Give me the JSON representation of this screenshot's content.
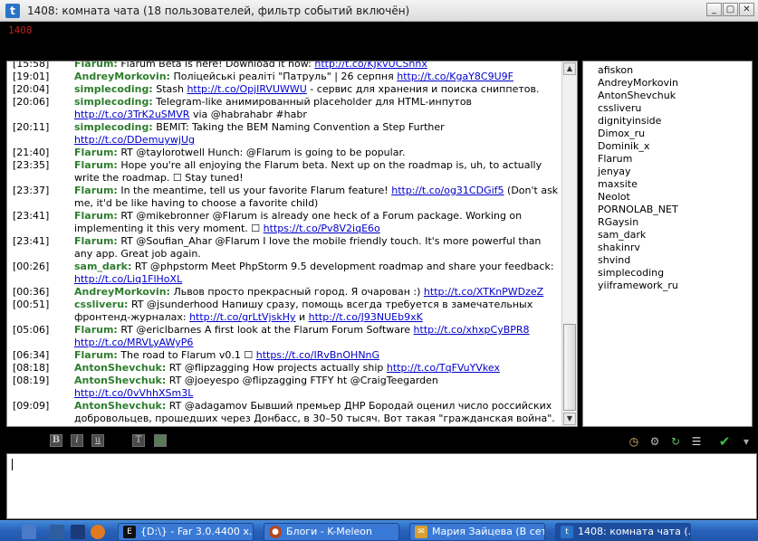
{
  "window": {
    "title": "1408: комната чата (18 пользователей, фильтр событий включён)",
    "app_icon_glyph": "t",
    "controls": {
      "minimize": "_",
      "restore": "▢",
      "close": "✕"
    }
  },
  "room": {
    "number": "1408"
  },
  "messages": [
    {
      "time": "[15:58]",
      "nick": "Flarum:",
      "parts": [
        {
          "t": " Flarum Beta is here! Download it now: "
        },
        {
          "l": "http://t.co/KJkvUCShnx"
        }
      ]
    },
    {
      "time": "[19:01]",
      "nick": "AndreyMorkovin:",
      "parts": [
        {
          "t": " Поліцейські реаліті \"Патруль\" | 26 серпня "
        },
        {
          "l": "http://t.co/KgaY8C9U9F"
        }
      ]
    },
    {
      "time": "[20:04]",
      "nick": "simplecoding:",
      "parts": [
        {
          "t": " Stash "
        },
        {
          "l": "http://t.co/OpjIRVUWWU"
        },
        {
          "t": " - сервис для хранения и поиска сниппетов."
        }
      ]
    },
    {
      "time": "[20:06]",
      "nick": "simplecoding:",
      "parts": [
        {
          "t": " Telegram-like анимированный placeholder для HTML-инпутов "
        },
        {
          "l": "http://t.co/3TrK2uSMVR"
        },
        {
          "t": " via @habrahabr #habr"
        }
      ]
    },
    {
      "time": "[20:11]",
      "nick": "simplecoding:",
      "parts": [
        {
          "t": " BEMIT: Taking the BEM Naming Convention a Step Further "
        },
        {
          "l": "http://t.co/DDemuywjUg"
        }
      ]
    },
    {
      "time": "[21:40]",
      "nick": "Flarum:",
      "parts": [
        {
          "t": " RT @taylorotwell Hunch: @Flarum is going to be popular."
        }
      ]
    },
    {
      "time": "[23:35]",
      "nick": "Flarum:",
      "parts": [
        {
          "t": " Hope you're all enjoying the Flarum beta. Next up on the roadmap is, uh, to actually write the roadmap. ☐ Stay tuned!"
        }
      ]
    },
    {
      "time": "[23:37]",
      "nick": "Flarum:",
      "parts": [
        {
          "t": " In the meantime, tell us your favorite Flarum feature! "
        },
        {
          "l": "http://t.co/og31CDGif5"
        },
        {
          "t": " (Don't ask me, it'd be like having to choose a favorite child)"
        }
      ]
    },
    {
      "time": "[23:41]",
      "nick": "Flarum:",
      "parts": [
        {
          "t": " RT @mikebronner @Flarum is already one heck of a Forum package. Working on implementing it this very moment. ☐ "
        },
        {
          "l": "https://t.co/Pv8V2iqE6o"
        }
      ]
    },
    {
      "time": "[23:41]",
      "nick": "Flarum:",
      "parts": [
        {
          "t": " RT @Soufian_Ahar @Flarum I love the mobile friendly touch. It's more powerful than any app. Great job again."
        }
      ]
    },
    {
      "time": "[00:26]",
      "nick": "sam_dark:",
      "parts": [
        {
          "t": " RT @phpstorm Meet PhpStorm 9.5 development roadmap and share your feedback: "
        },
        {
          "l": "http://t.co/Liq1FlHoXL"
        }
      ]
    },
    {
      "time": "[00:36]",
      "nick": "AndreyMorkovin:",
      "parts": [
        {
          "t": " Львов просто прекрасный город. Я очарован :) "
        },
        {
          "l": "http://t.co/XTKnPWDzeZ"
        }
      ]
    },
    {
      "time": "[00:51]",
      "nick": "cssliveru:",
      "parts": [
        {
          "t": " RT @jsunderhood Напишу сразу, помощь всегда требуется в замечательных фронтенд-журналах: "
        },
        {
          "l": "http://t.co/grLtVjskHy"
        },
        {
          "t": " и "
        },
        {
          "l": "http://t.co/J93NUEb9xK"
        }
      ]
    },
    {
      "time": "[05:06]",
      "nick": "Flarum:",
      "parts": [
        {
          "t": " RT @ericlbarnes A first look at the Flarum Forum Software "
        },
        {
          "l": "http://t.co/xhxpCyBPR8"
        },
        {
          "t": " "
        },
        {
          "l": "http://t.co/MRVLyAWyP6"
        }
      ]
    },
    {
      "time": "[06:34]",
      "nick": "Flarum:",
      "parts": [
        {
          "t": " The road to Flarum v0.1 ☐ "
        },
        {
          "l": "https://t.co/IRvBnOHNnG"
        }
      ]
    },
    {
      "time": "[08:18]",
      "nick": "AntonShevchuk:",
      "parts": [
        {
          "t": " RT @flipzagging How projects actually ship "
        },
        {
          "l": "http://t.co/TqFVuYVkex"
        }
      ]
    },
    {
      "time": "[08:19]",
      "nick": "AntonShevchuk:",
      "parts": [
        {
          "t": " RT @joeyespo @flipzagging FTFY ht @CraigTeegarden "
        },
        {
          "l": "http://t.co/0vVhhXSm3L"
        }
      ]
    },
    {
      "time": "[09:09]",
      "nick": "AntonShevchuk:",
      "parts": [
        {
          "t": " RT @adagamov Бывший премьер ДНР Бородай оценил число российских добровольцев, прошедших через Донбасс, в 30–50 тысяч. Вот такая \"гражданская война\"."
        }
      ]
    }
  ],
  "scroll": {
    "up_glyph": "▲",
    "down_glyph": "▼"
  },
  "users": [
    "afiskon",
    "AndreyMorkovin",
    "AntonShevchuk",
    "cssliveru",
    "dignityinside",
    "Dimox_ru",
    "Dominik_x",
    "Flarum",
    "jenyay",
    "maxsite",
    "Neolot",
    "PORNOLAB_NET",
    "RGaysin",
    "sam_dark",
    "shakinrv",
    "shvind",
    "simplecoding",
    "yiiframework_ru"
  ],
  "toolbar": {
    "bold": "B",
    "italic": "i",
    "underline": "u",
    "text": "T",
    "clock_glyph": "◷",
    "gear_glyph": "⚙",
    "refresh_glyph": "↻",
    "list_glyph": "☰",
    "send_glyph": "✔",
    "more_glyph": "▾"
  },
  "input": {
    "value": "",
    "placeholder": ""
  },
  "taskbar": {
    "tasks": [
      {
        "label": "{D:\\} - Far 3.0.4400 x...",
        "icon": "E"
      },
      {
        "label": "Блоги - K-Meleon",
        "icon": "●"
      },
      {
        "label": "Мария Зайцева (В сети)",
        "icon": "✉"
      },
      {
        "label": "1408: комната чата (...",
        "icon": "t"
      }
    ]
  }
}
